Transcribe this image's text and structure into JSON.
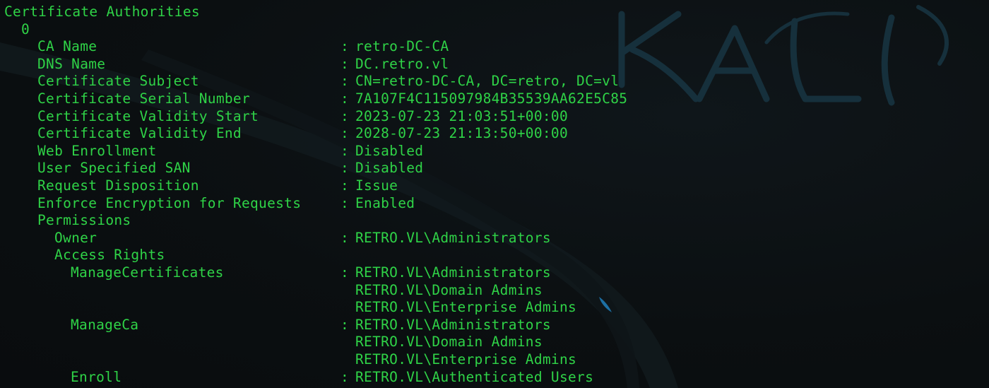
{
  "colors": {
    "background": "#0b0f11",
    "text": "#2fd347",
    "kali_logo": "#16303c"
  },
  "wallpaper": {
    "logo_icon": "kali-dragon-icon",
    "logo_text": "KALI"
  },
  "output": {
    "title": "Certificate Authorities",
    "index": "0",
    "separator": ":",
    "fields": [
      {
        "key": "CA Name",
        "value": "retro-DC-CA"
      },
      {
        "key": "DNS Name",
        "value": "DC.retro.vl"
      },
      {
        "key": "Certificate Subject",
        "value": "CN=retro-DC-CA, DC=retro, DC=vl"
      },
      {
        "key": "Certificate Serial Number",
        "value": "7A107F4C115097984B35539AA62E5C85"
      },
      {
        "key": "Certificate Validity Start",
        "value": "2023-07-23 21:03:51+00:00"
      },
      {
        "key": "Certificate Validity End",
        "value": "2028-07-23 21:13:50+00:00"
      },
      {
        "key": "Web Enrollment",
        "value": "Disabled"
      },
      {
        "key": "User Specified SAN",
        "value": "Disabled"
      },
      {
        "key": "Request Disposition",
        "value": "Issue"
      },
      {
        "key": "Enforce Encryption for Requests",
        "value": "Enabled"
      }
    ],
    "permissions": {
      "label": "Permissions",
      "owner": {
        "key": "Owner",
        "value": "RETRO.VL\\Administrators"
      },
      "access_rights_label": "Access Rights",
      "rights": [
        {
          "key": "ManageCertificates",
          "values": [
            "RETRO.VL\\Administrators",
            "RETRO.VL\\Domain Admins",
            "RETRO.VL\\Enterprise Admins"
          ]
        },
        {
          "key": "ManageCa",
          "values": [
            "RETRO.VL\\Administrators",
            "RETRO.VL\\Domain Admins",
            "RETRO.VL\\Enterprise Admins"
          ]
        },
        {
          "key": "Enroll",
          "values": [
            "RETRO.VL\\Authenticated Users"
          ]
        }
      ]
    }
  }
}
